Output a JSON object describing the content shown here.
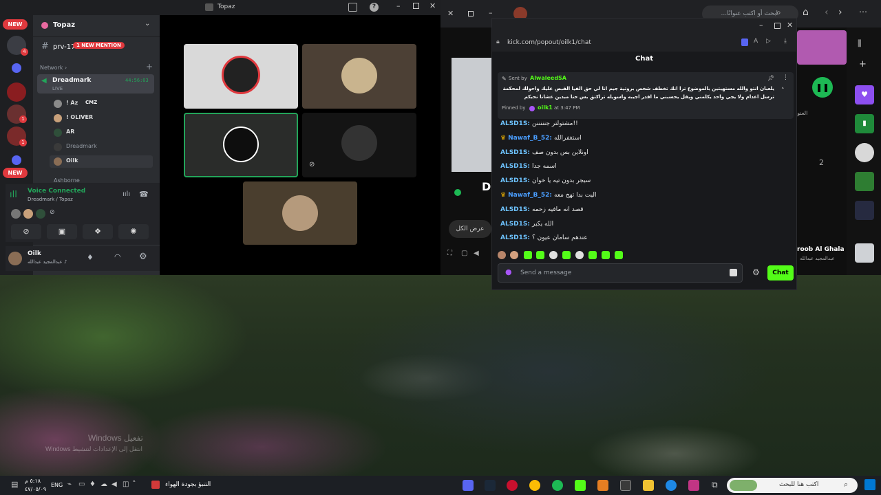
{
  "desktop": {
    "watermark_title": "Windows تفعيل",
    "watermark_sub": "Windows انتقل إلى الإعدادات لتنشيط"
  },
  "discord": {
    "window_title": "Topaz",
    "server_name": "Topaz",
    "new_badge_1": "NEW",
    "new_badge_2": "NEW",
    "badge_count_1": "4",
    "badge_count_2": "1",
    "badge_count_3": "1",
    "channel_name": "prv-17",
    "mention_badge": "1 NEW MENTION",
    "category": "Network",
    "voice_channel": "Dreadmark",
    "voice_timer": "44:56:03",
    "live_label": "LIVE",
    "members": [
      {
        "name": "! Az",
        "tag": "CMZ"
      },
      {
        "name": "! OLIVER",
        "tag": ""
      },
      {
        "name": "AR",
        "tag": ""
      },
      {
        "name": "Dreadmark",
        "tag": ""
      },
      {
        "name": "Oilk",
        "tag": ""
      }
    ],
    "next_channel": "Ashborne",
    "voice_status": "Voice Connected",
    "voice_location": "Dreadmark / Topaz",
    "user_name": "Oilk",
    "user_status": "عبدالمجيد عبدالله ♪"
  },
  "browser": {
    "tab_search_placeholder": "...ابحث أو اكتب عنوانًا",
    "popup_url": "kick.com/popout/oilk1/chat",
    "chat_title": "Chat",
    "pinned_sent_by_label": "Sent by",
    "pinned_sender": "AlwaleedSA",
    "pinned_text": "يلعبان انتو والله مستهيتين بالموضوع ترا انك تخطف شخص بروتية جيم انا لي حق الفيا القبض عليك واحولك لمحكمة ترسل اعدام ولا يجي واحد يكلمني ويقل يحسبني ما اقدر اجيبه واسويله تراكتق بس حنا مبدين عشانا نحبكم",
    "pinned_by_label": "Pinned by",
    "pinned_by": "oilk1",
    "pinned_time": "at 3:47 PM",
    "messages": [
      {
        "user": "ALSD1S:",
        "text": "مشتولتر جنننننن!!"
      },
      {
        "user": "Nawaf_B_52:",
        "text": "استغفرالله"
      },
      {
        "user": "ALSD1S:",
        "text": "اونلاين بس بدون صف"
      },
      {
        "user": "ALSD1S:",
        "text": "اسمه جدا"
      },
      {
        "user": "ALSD1S:",
        "text": "سيجر بدون تيه يا خوان"
      },
      {
        "user": "Nawaf_B_52:",
        "text": "اليت بدا تهج معه"
      },
      {
        "user": "ALSD1S:",
        "text": "قصد انه مافيه زحمه"
      },
      {
        "user": "ALSD1S:",
        "text": "الله يكبر"
      },
      {
        "user": "ALSD1S:",
        "text": "عندهم سامان عيون ؟"
      }
    ],
    "send_placeholder": "Send a message",
    "chat_button": "Chat",
    "page_show_all": "عرض الكل",
    "page_letter": "D",
    "artist_name": "roob Al Ghala",
    "artist_sub": "عبدالمجيد عبدالله",
    "side_num": "2",
    "side_label": "العنوا",
    "colors": {
      "kick_green": "#53fc18",
      "discord_green": "#23a55a",
      "discord_red": "#e0393e",
      "blurple": "#5865f2"
    }
  },
  "taskbar": {
    "weather": "التنبؤ بجودة الهواء",
    "time": "٥:١٨ م",
    "date": "٤٧/٠٥/٠٩",
    "lang": "ENG",
    "search_placeholder": "اكتب هنا للبحث"
  }
}
